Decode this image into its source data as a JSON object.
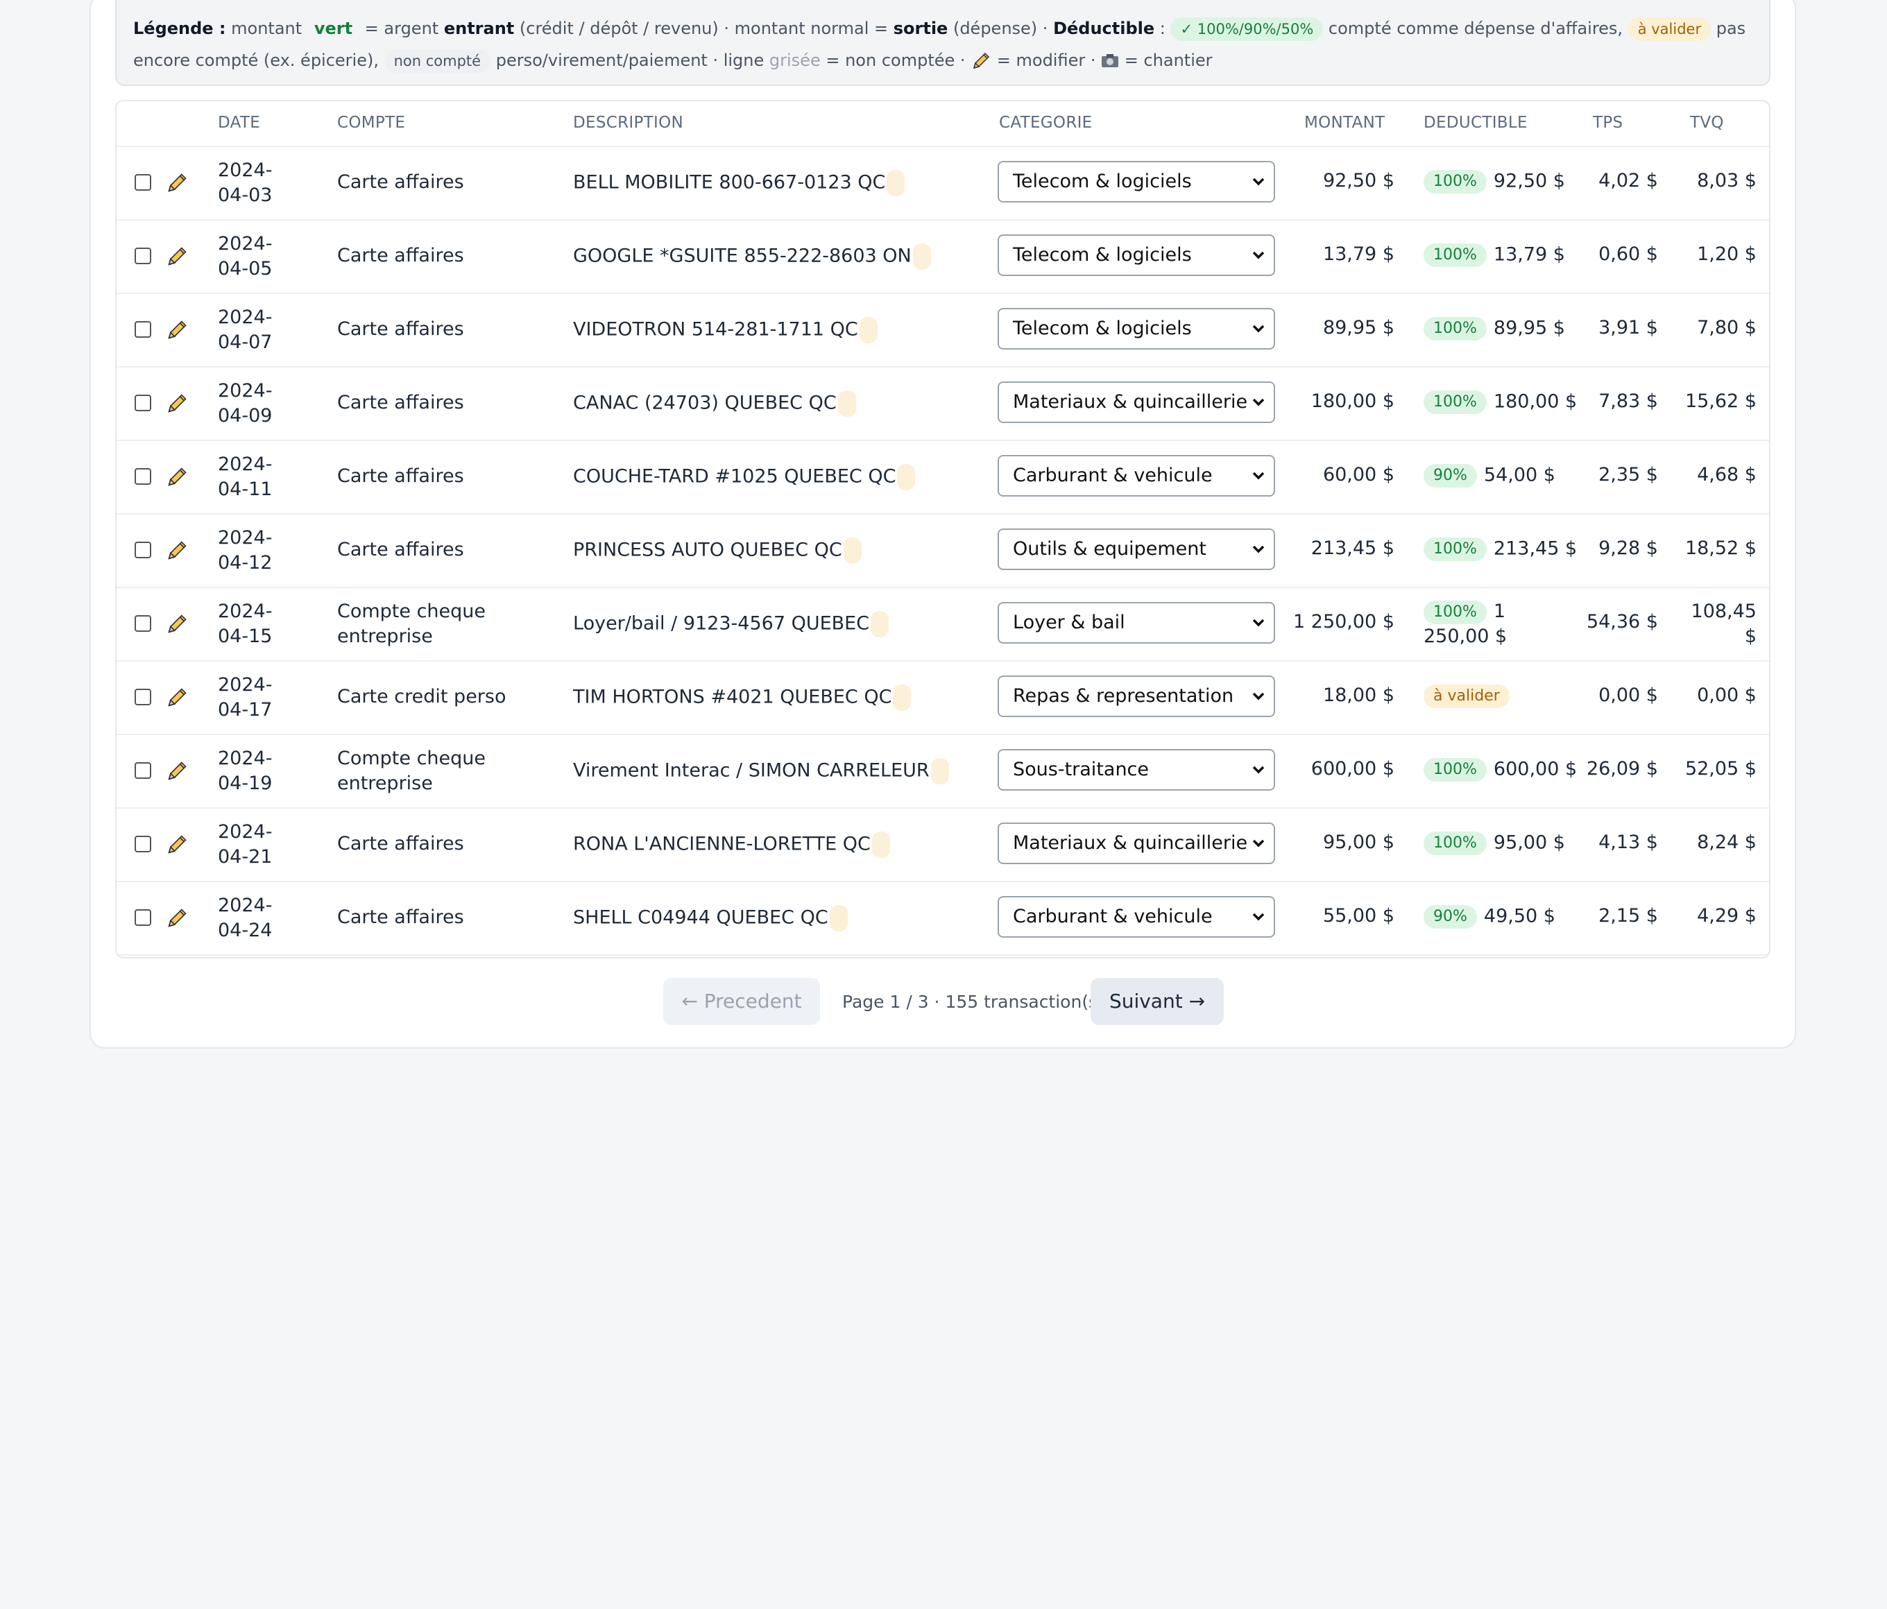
{
  "legend": {
    "label": "Légende :",
    "t1": " montant ",
    "green_word": "vert",
    "t2": " = argent ",
    "entrant": "entrant",
    "t3": " (crédit / dépôt / revenu) · montant normal = ",
    "sortie": "sortie",
    "t4": " (dépense) · ",
    "deductible": "Déductible",
    "t5": " : ",
    "pill_ok": "✓ 100%/90%/50%",
    "t6": " compté comme dépense d'affaires, ",
    "pill_validate": "à valider",
    "t7": " pas encore compté (ex. épicerie), ",
    "pill_not_counted": "non compté",
    "t8": " perso/virement/paiement · ligne ",
    "greyed": "grisée",
    "t9": " = non comptée · ",
    "t10": " = modifier · ",
    "t11": " = chantier"
  },
  "table": {
    "headers": {
      "date": "DATE",
      "account": "COMPTE",
      "description": "DESCRIPTION",
      "category": "CATEGORIE",
      "amount": "MONTANT",
      "deductible": "DEDUCTIBLE",
      "tps": "TPS",
      "tvq": "TVQ"
    },
    "rows": [
      {
        "date": "2024-04-03",
        "account": "Carte affaires",
        "description": "BELL MOBILITE 800-667-0123 QC",
        "category": "Telecom & logiciels",
        "amount": "92,50 $",
        "ded_pill": "100%",
        "ded_amount": "92,50 $",
        "tps": "4,02 $",
        "tvq": "8,03 $"
      },
      {
        "date": "2024-04-05",
        "account": "Carte affaires",
        "description": "GOOGLE *GSUITE 855-222-8603 ON",
        "category": "Telecom & logiciels",
        "amount": "13,79 $",
        "ded_pill": "100%",
        "ded_amount": "13,79 $",
        "tps": "0,60 $",
        "tvq": "1,20 $"
      },
      {
        "date": "2024-04-07",
        "account": "Carte affaires",
        "description": "VIDEOTRON 514-281-1711 QC",
        "category": "Telecom & logiciels",
        "amount": "89,95 $",
        "ded_pill": "100%",
        "ded_amount": "89,95 $",
        "tps": "3,91 $",
        "tvq": "7,80 $"
      },
      {
        "date": "2024-04-09",
        "account": "Carte affaires",
        "description": "CANAC (24703) QUEBEC QC",
        "category": "Materiaux & quincaillerie",
        "amount": "180,00 $",
        "ded_pill": "100%",
        "ded_amount": "180,00 $",
        "tps": "7,83 $",
        "tvq": "15,62 $"
      },
      {
        "date": "2024-04-11",
        "account": "Carte affaires",
        "description": "COUCHE-TARD #1025 QUEBEC QC",
        "category": "Carburant & vehicule",
        "amount": "60,00 $",
        "ded_pill": "90%",
        "ded_amount": "54,00 $",
        "tps": "2,35 $",
        "tvq": "4,68 $"
      },
      {
        "date": "2024-04-12",
        "account": "Carte affaires",
        "description": "PRINCESS AUTO QUEBEC QC",
        "category": "Outils & equipement",
        "amount": "213,45 $",
        "ded_pill": "100%",
        "ded_amount": "213,45 $",
        "tps": "9,28 $",
        "tvq": "18,52 $"
      },
      {
        "date": "2024-04-15",
        "account": "Compte cheque entreprise",
        "description": "Loyer/bail / 9123-4567 QUEBEC",
        "category": "Loyer & bail",
        "amount": "1 250,00 $",
        "ded_pill": "100%",
        "ded_amount": "1 250,00 $",
        "tps": "54,36 $",
        "tvq": "108,45 $"
      },
      {
        "date": "2024-04-17",
        "account": "Carte credit perso",
        "description": "TIM HORTONS #4021 QUEBEC QC",
        "category": "Repas & representation",
        "amount": "18,00 $",
        "ded_pill": "à valider",
        "ded_amount": "",
        "tps": "0,00 $",
        "tvq": "0,00 $"
      },
      {
        "date": "2024-04-19",
        "account": "Compte cheque entreprise",
        "description": "Virement Interac / SIMON CARRELEUR",
        "category": "Sous-traitance",
        "amount": "600,00 $",
        "ded_pill": "100%",
        "ded_amount": "600,00 $",
        "tps": "26,09 $",
        "tvq": "52,05 $"
      },
      {
        "date": "2024-04-21",
        "account": "Carte affaires",
        "description": "RONA L'ANCIENNE-LORETTE QC",
        "category": "Materiaux & quincaillerie",
        "amount": "95,00 $",
        "ded_pill": "100%",
        "ded_amount": "95,00 $",
        "tps": "4,13 $",
        "tvq": "8,24 $"
      },
      {
        "date": "2024-04-24",
        "account": "Carte affaires",
        "description": "SHELL C04944 QUEBEC QC",
        "category": "Carburant & vehicule",
        "amount": "55,00 $",
        "ded_pill": "90%",
        "ded_amount": "49,50 $",
        "tps": "2,15 $",
        "tvq": "4,29 $"
      }
    ]
  },
  "pagination": {
    "prev_label": "← Precedent",
    "info": "Page 1 / 3 · 155 transaction(s)",
    "next_label": "Suivant →"
  },
  "colors": {
    "income_green": "#15803d",
    "pill_green_bg": "#dcf5e3",
    "pill_amber_bg": "#fdf0d3",
    "pill_amber_text": "#a16207"
  },
  "icons": {
    "edit": "pencil-icon",
    "site": "camera-icon",
    "select": "chevron-down-icon"
  }
}
